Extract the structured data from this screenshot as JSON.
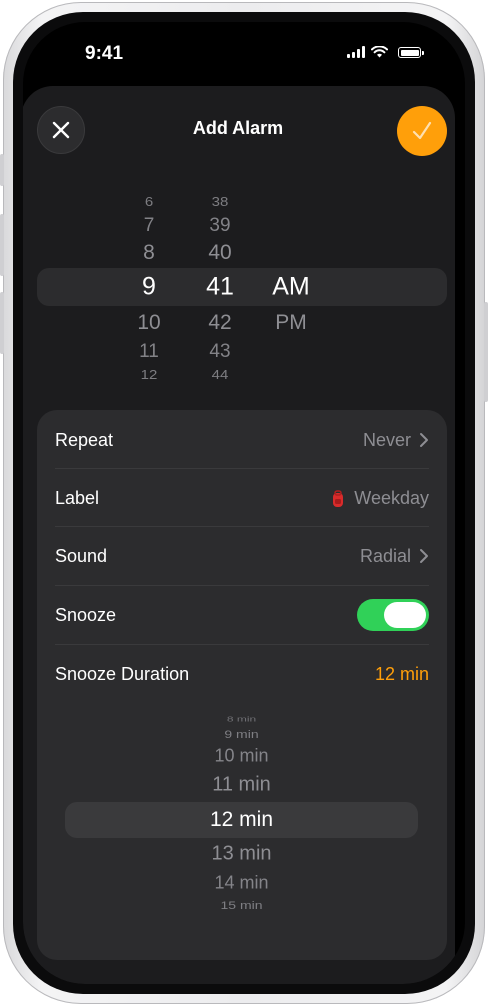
{
  "status_bar": {
    "time": "9:41"
  },
  "header": {
    "title": "Add Alarm"
  },
  "time_picker": {
    "hours": [
      "6",
      "7",
      "8",
      "9",
      "10",
      "11",
      "12"
    ],
    "minutes": [
      "38",
      "39",
      "40",
      "41",
      "42",
      "43",
      "44"
    ],
    "periods": [
      "AM",
      "PM"
    ],
    "selected_hour": "9",
    "selected_minute": "41",
    "selected_period": "AM"
  },
  "settings": {
    "repeat": {
      "label": "Repeat",
      "value": "Never"
    },
    "label": {
      "label": "Label",
      "value": "Weekday"
    },
    "sound": {
      "label": "Sound",
      "value": "Radial"
    },
    "snooze": {
      "label": "Snooze",
      "on": true
    },
    "snooze_duration": {
      "label": "Snooze Duration",
      "value": "12 min"
    }
  },
  "duration_picker": {
    "options": [
      "8 min",
      "9 min",
      "10 min",
      "11 min",
      "12 min",
      "13 min",
      "14 min",
      "15 min"
    ],
    "selected": "12 min"
  },
  "colors": {
    "accent": "#ff9f0a",
    "toggle_on": "#30d158",
    "sheet": "#1c1c1e",
    "card": "#2c2c2e"
  },
  "icons": {
    "close": "xmark-icon",
    "done": "checkmark-icon",
    "chevron": "chevron-right-icon",
    "label": "backpack-emoji-icon"
  }
}
